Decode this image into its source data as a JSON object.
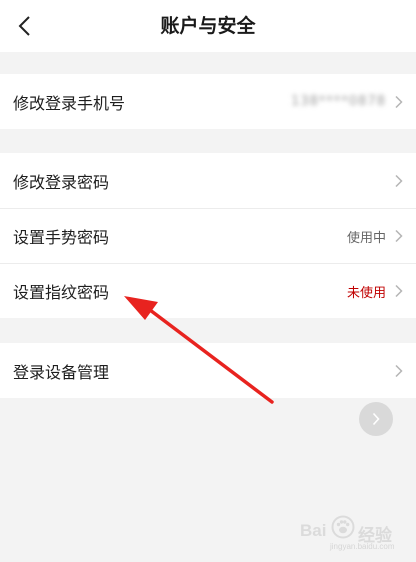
{
  "header": {
    "title": "账户与安全"
  },
  "groups": [
    {
      "rows": [
        {
          "label": "修改登录手机号",
          "value": "138****0878"
        }
      ]
    },
    {
      "rows": [
        {
          "label": "修改登录密码",
          "value": ""
        },
        {
          "label": "设置手势密码",
          "value": "使用中"
        },
        {
          "label": "设置指纹密码",
          "value": "未使用"
        }
      ]
    },
    {
      "rows": [
        {
          "label": "登录设备管理",
          "value": ""
        }
      ]
    }
  ],
  "watermark": {
    "brand_left": "Bai",
    "brand_right": "经验",
    "sub": "jingyan.baidu.com"
  },
  "colors": {
    "status_unused": "#c00000",
    "annotation_arrow": "#e8231f"
  }
}
